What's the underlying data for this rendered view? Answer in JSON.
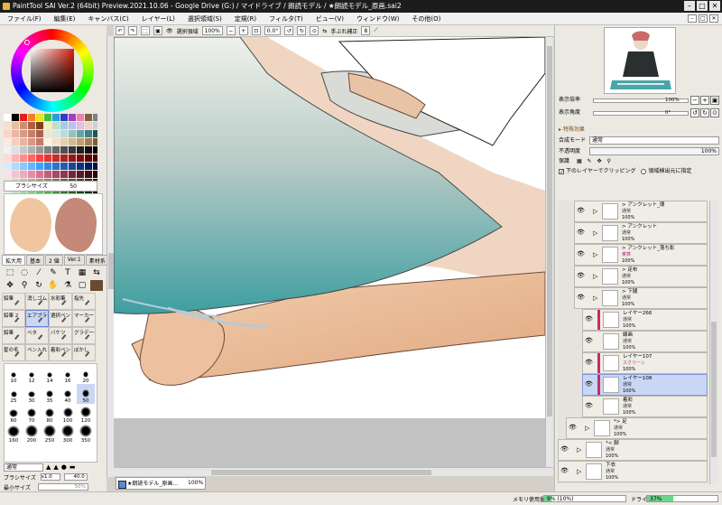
{
  "window": {
    "title": "PaintTool SAI Ver.2 (64bit) Preview.2021.10.06 - Google Drive (G:) / マイドライブ / 朗読モデル / ★朗読モデル_原画.sai2"
  },
  "menu": [
    "ファイル(F)",
    "編集(E)",
    "キャンバス(C)",
    "レイヤー(L)",
    "選択領域(S)",
    "定規(R)",
    "フィルタ(T)",
    "ビュー(V)",
    "ウィンドウ(W)",
    "その他(O)"
  ],
  "brush": {
    "label": "ブラシサイズ",
    "value": "50"
  },
  "tool_tabs": [
    "拡大用",
    "基本",
    "2 値",
    "Ver.1",
    "素材系"
  ],
  "tools": [
    {
      "label": "鉛筆",
      "selected": false
    },
    {
      "label": "消しゴム",
      "selected": false
    },
    {
      "label": "水彩筆",
      "selected": false
    },
    {
      "label": "指先",
      "selected": false
    },
    {
      "label": "鉛筆 2",
      "selected": false
    },
    {
      "label": "エアブラシ",
      "selected": true
    },
    {
      "label": "選択ペン",
      "selected": false
    },
    {
      "label": "マーカー",
      "selected": false
    },
    {
      "label": "鉛筆",
      "selected": false
    },
    {
      "label": "ベタ",
      "selected": false
    },
    {
      "label": "バケツ",
      "selected": false
    },
    {
      "label": "グラデーション",
      "selected": false
    },
    {
      "label": "髪の毛",
      "selected": false
    },
    {
      "label": "ペン入れ",
      "selected": false
    },
    {
      "label": "着彩ペン",
      "selected": false
    },
    {
      "label": "ぼかし",
      "selected": false
    }
  ],
  "brush_sizes": [
    {
      "label": "10",
      "selected": false
    },
    {
      "label": "12",
      "selected": false
    },
    {
      "label": "14",
      "selected": false
    },
    {
      "label": "16",
      "selected": false
    },
    {
      "label": "20",
      "selected": false
    },
    {
      "label": "25",
      "selected": false
    },
    {
      "label": "30",
      "selected": false
    },
    {
      "label": "35",
      "selected": false
    },
    {
      "label": "40",
      "selected": false
    },
    {
      "label": "50",
      "selected": true
    },
    {
      "label": "60",
      "selected": false
    },
    {
      "label": "70",
      "selected": false
    },
    {
      "label": "80",
      "selected": false
    },
    {
      "label": "100",
      "selected": false
    },
    {
      "label": "120",
      "selected": false
    },
    {
      "label": "160",
      "selected": false
    },
    {
      "label": "200",
      "selected": false
    },
    {
      "label": "250",
      "selected": false
    },
    {
      "label": "300",
      "selected": false
    },
    {
      "label": "350",
      "selected": false
    }
  ],
  "blend_mode": "通常",
  "brush_size_row": {
    "label": "ブラシサイズ",
    "multiplier": "x1.0",
    "value": "40.0"
  },
  "min_size_row": {
    "label": "最小サイズ",
    "value": "50%"
  },
  "toolbar": {
    "selection_label": "選択領域",
    "zoom": "100%",
    "angle": "0.0°",
    "stabilizer_label": "手ぶれ補正",
    "stabilizer_value": "8"
  },
  "doc_tab": {
    "name": "★朗読モデル_原画...",
    "zoom": "100%"
  },
  "navigator": {
    "zoom_label": "表示倍率",
    "zoom_value": "100%",
    "angle_label": "表示角度",
    "angle_value": "0°"
  },
  "layer_props": {
    "section": "▸ 特殊効果",
    "blend_label": "合成モード",
    "blend_value": "通常",
    "opacity_label": "不透明度",
    "opacity_value": "100%",
    "protect_label": "保護",
    "clip_label": "下のレイヤーでクリッピング",
    "clip_checked": true,
    "select_source_label": "領域検出元に指定"
  },
  "layers": [
    {
      "name": "> アンクレット_環",
      "mode": "通常",
      "opacity": "100%",
      "indent": 2,
      "folder": true,
      "selected": false,
      "clip": false,
      "mode_color": "#333333"
    },
    {
      "name": "> アンクレット",
      "mode": "通常",
      "opacity": "100%",
      "indent": 2,
      "folder": true,
      "selected": false,
      "clip": false,
      "mode_color": "#333333"
    },
    {
      "name": "> アンクレット_落ち影",
      "mode": "乗算",
      "opacity": "100%",
      "indent": 2,
      "folder": true,
      "selected": false,
      "clip": false,
      "mode_color": "#b8327a"
    },
    {
      "name": "> 足布",
      "mode": "通常",
      "opacity": "100%",
      "indent": 2,
      "folder": true,
      "selected": false,
      "clip": false,
      "mode_color": "#333333"
    },
    {
      "name": "> 下腿",
      "mode": "通常",
      "opacity": "100%",
      "indent": 2,
      "folder": true,
      "selected": false,
      "clip": false,
      "mode_color": "#333333"
    },
    {
      "name": "レイヤー266",
      "mode": "通常",
      "opacity": "100%",
      "indent": 3,
      "folder": false,
      "selected": false,
      "clip": true,
      "mode_color": "#333333"
    },
    {
      "name": "線画",
      "mode": "通常",
      "opacity": "100%",
      "indent": 3,
      "folder": false,
      "selected": false,
      "clip": false,
      "mode_color": "#333333"
    },
    {
      "name": "レイヤー107",
      "mode": "スクリーン",
      "opacity": "100%",
      "indent": 3,
      "folder": false,
      "selected": false,
      "clip": true,
      "mode_color": "#b8327a"
    },
    {
      "name": "レイヤー108",
      "mode": "通常",
      "opacity": "100%",
      "indent": 3,
      "folder": false,
      "selected": true,
      "clip": true,
      "mode_color": "#333333"
    },
    {
      "name": "着彩",
      "mode": "通常",
      "opacity": "100%",
      "indent": 3,
      "folder": false,
      "selected": false,
      "clip": false,
      "mode_color": "#333333"
    },
    {
      "name": "*> 足",
      "mode": "通常",
      "opacity": "100%",
      "indent": 1,
      "folder": true,
      "selected": false,
      "clip": false,
      "mode_color": "#333333"
    },
    {
      "name": "*< 脚",
      "mode": "通常",
      "opacity": "100%",
      "indent": 0,
      "folder": true,
      "selected": false,
      "clip": false,
      "mode_color": "#333333"
    },
    {
      "name": "下衣",
      "mode": "通常",
      "opacity": "100%",
      "indent": 0,
      "folder": true,
      "selected": false,
      "clip": false,
      "mode_color": "#333333"
    }
  ],
  "status": {
    "mem_label": "メモリ使用量",
    "mem_value": "9% (10%)",
    "mem_fraction": 0.09,
    "drive_label": "ドライブ使用量",
    "drive_value": "37%",
    "drive_fraction": 0.37
  }
}
